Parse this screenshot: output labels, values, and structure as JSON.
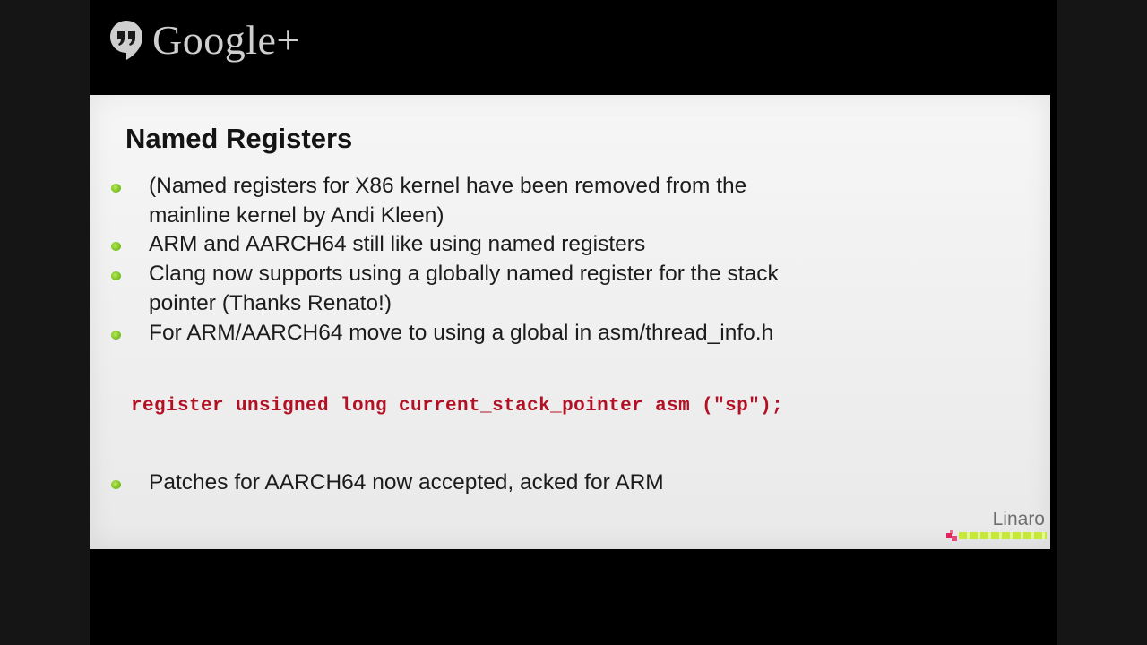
{
  "brand": {
    "name": "Google+"
  },
  "slide": {
    "title": "Named Registers",
    "bullets": [
      {
        "line1": "(Named registers for X86 kernel have been removed from the",
        "line2": "mainline kernel by Andi Kleen)"
      },
      {
        "line1": "ARM and AARCH64 still like using named registers"
      },
      {
        "line1": "Clang now supports using a globally named register for the stack",
        "line2": "pointer (Thanks Renato!)"
      },
      {
        "line1": "For ARM/AARCH64 move to using a global in asm/thread_info.h"
      },
      {
        "line1": "Patches for AARCH64 now accepted, acked for ARM"
      }
    ],
    "code": "register unsigned long current_stack_pointer asm (\"sp\");",
    "logo_text": "Linaro"
  },
  "colors": {
    "bullet": "#7cc322",
    "code": "#b31024",
    "logo_bar": "#c6e83a",
    "logo_mark": "#e0245e"
  }
}
